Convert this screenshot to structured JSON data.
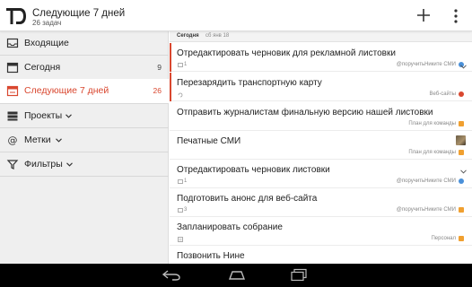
{
  "app": {
    "title": "Следующие 7 дней",
    "subtitle": "26 задач",
    "logo_text": "TD"
  },
  "colors": {
    "accent": "#d9472f",
    "blue_dot": "#4a90d9",
    "orange_dot": "#f0a030"
  },
  "icons": {
    "add": "plus-icon",
    "more": "more-vert-icon"
  },
  "sidebar": {
    "items": [
      {
        "label": "Входящие",
        "count": "",
        "icon": "inbox-icon"
      },
      {
        "label": "Сегодня",
        "count": "9",
        "icon": "calendar-icon"
      },
      {
        "label": "Следующие 7 дней",
        "count": "26",
        "icon": "calendar-week-icon"
      },
      {
        "label": "Проекты",
        "count": "",
        "icon": "projects-icon"
      },
      {
        "label": "Метки",
        "count": "",
        "icon": "at-icon"
      },
      {
        "label": "Фильтры",
        "count": "",
        "icon": "filter-icon"
      }
    ]
  },
  "section": {
    "title": "Сегодня",
    "date": "сб янв 18"
  },
  "tasks": [
    {
      "title": "Отредактировать черновик для рекламной листовки",
      "meta_num": "1",
      "meta_right": "@поручитьНиките    СМИ"
    },
    {
      "title": "Перезарядить транспортную карту",
      "meta_num": "",
      "meta_right": "Веб-сайты"
    },
    {
      "title": "Отправить журналистам финальную версию нашей листовки",
      "meta_num": "",
      "meta_right": "План для команды"
    },
    {
      "title": "Печатные СМИ",
      "meta_num": "",
      "meta_right": "План для команды"
    },
    {
      "title": "Отредактировать черновик листовки",
      "meta_num": "1",
      "meta_right": "@поручитьНиките    СМИ"
    },
    {
      "title": "Подготовить анонс для веб-сайта",
      "meta_num": "3",
      "meta_right": "@поручитьНиките    СМИ"
    },
    {
      "title": "Запланировать собрание",
      "meta_num": "",
      "meta_right": "Персонал"
    },
    {
      "title": "Позвонить Нине",
      "meta_num": "",
      "meta_right": ""
    }
  ],
  "system_nav": {
    "back": "back-icon",
    "home": "home-icon",
    "recent": "recent-apps-icon"
  }
}
